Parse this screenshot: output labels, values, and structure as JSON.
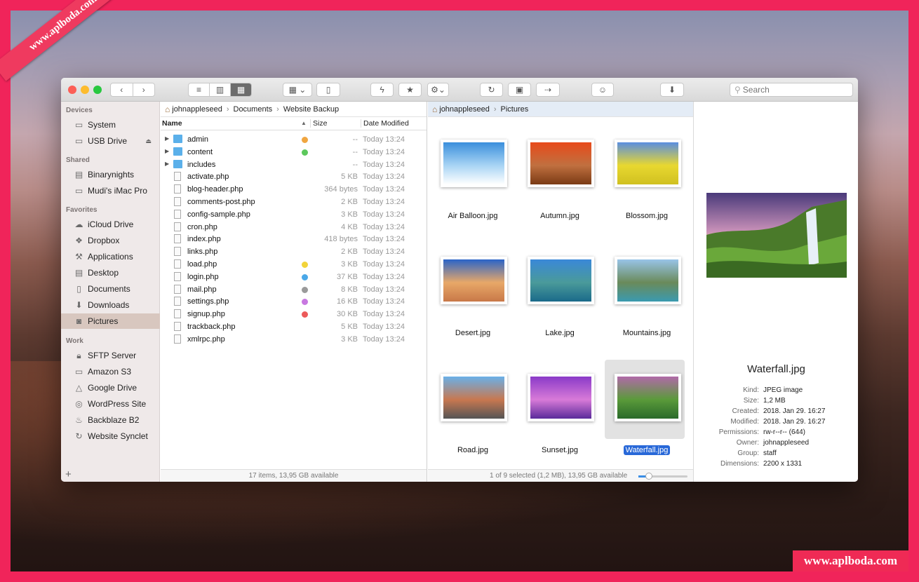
{
  "watermark": {
    "ribbon": "www.aplboda.com",
    "corner": "www.aplboda.com"
  },
  "toolbar": {
    "search_placeholder": "Search"
  },
  "sidebar": {
    "devices": {
      "title": "Devices",
      "items": [
        {
          "label": "System",
          "icon": "hard-drive-icon"
        },
        {
          "label": "USB Drive",
          "icon": "usb-drive-icon"
        }
      ]
    },
    "shared": {
      "title": "Shared",
      "items": [
        {
          "label": "Binarynights",
          "icon": "network-server-icon"
        },
        {
          "label": "Mudi's iMac Pro",
          "icon": "imac-icon"
        }
      ]
    },
    "favorites": {
      "title": "Favorites",
      "items": [
        {
          "label": "iCloud Drive",
          "icon": "cloud-icon"
        },
        {
          "label": "Dropbox",
          "icon": "dropbox-icon"
        },
        {
          "label": "Applications",
          "icon": "applications-icon"
        },
        {
          "label": "Desktop",
          "icon": "desktop-icon"
        },
        {
          "label": "Documents",
          "icon": "documents-icon"
        },
        {
          "label": "Downloads",
          "icon": "downloads-icon"
        },
        {
          "label": "Pictures",
          "icon": "camera-icon"
        }
      ]
    },
    "work": {
      "title": "Work",
      "items": [
        {
          "label": "SFTP Server",
          "icon": "lock-icon"
        },
        {
          "label": "Amazon S3",
          "icon": "bucket-icon"
        },
        {
          "label": "Google Drive",
          "icon": "google-drive-icon"
        },
        {
          "label": "WordPress Site",
          "icon": "wordpress-icon"
        },
        {
          "label": "Backblaze B2",
          "icon": "flame-icon"
        },
        {
          "label": "Website Synclet",
          "icon": "sync-icon"
        }
      ]
    },
    "selected": "Pictures"
  },
  "left_pane": {
    "breadcrumb": [
      "johnappleseed",
      "Documents",
      "Website Backup"
    ],
    "columns": {
      "name": "Name",
      "size": "Size",
      "date": "Date Modified"
    },
    "files": [
      {
        "name": "admin",
        "type": "folder",
        "size": "--",
        "date": "Today 13:24",
        "tag": "#f0a640"
      },
      {
        "name": "content",
        "type": "folder",
        "size": "--",
        "date": "Today 13:24",
        "tag": "#5cc85c"
      },
      {
        "name": "includes",
        "type": "folder",
        "size": "--",
        "date": "Today 13:24",
        "tag": ""
      },
      {
        "name": "activate.php",
        "type": "file",
        "size": "5 KB",
        "date": "Today 13:24",
        "tag": ""
      },
      {
        "name": "blog-header.php",
        "type": "file",
        "size": "364 bytes",
        "date": "Today 13:24",
        "tag": ""
      },
      {
        "name": "comments-post.php",
        "type": "file",
        "size": "2 KB",
        "date": "Today 13:24",
        "tag": ""
      },
      {
        "name": "config-sample.php",
        "type": "file",
        "size": "3 KB",
        "date": "Today 13:24",
        "tag": ""
      },
      {
        "name": "cron.php",
        "type": "file",
        "size": "4 KB",
        "date": "Today 13:24",
        "tag": ""
      },
      {
        "name": "index.php",
        "type": "file",
        "size": "418 bytes",
        "date": "Today 13:24",
        "tag": ""
      },
      {
        "name": "links.php",
        "type": "file",
        "size": "2 KB",
        "date": "Today 13:24",
        "tag": ""
      },
      {
        "name": "load.php",
        "type": "file",
        "size": "3 KB",
        "date": "Today 13:24",
        "tag": "#f2d43a"
      },
      {
        "name": "login.php",
        "type": "file",
        "size": "37 KB",
        "date": "Today 13:24",
        "tag": "#4aa8e8"
      },
      {
        "name": "mail.php",
        "type": "file",
        "size": "8 KB",
        "date": "Today 13:24",
        "tag": "#9a9a9a"
      },
      {
        "name": "settings.php",
        "type": "file",
        "size": "16 KB",
        "date": "Today 13:24",
        "tag": "#c878e0"
      },
      {
        "name": "signup.php",
        "type": "file",
        "size": "30 KB",
        "date": "Today 13:24",
        "tag": "#ec5a5a"
      },
      {
        "name": "trackback.php",
        "type": "file",
        "size": "5 KB",
        "date": "Today 13:24",
        "tag": ""
      },
      {
        "name": "xmlrpc.php",
        "type": "file",
        "size": "3 KB",
        "date": "Today 13:24",
        "tag": ""
      }
    ],
    "status": "17 items, 13,95 GB available"
  },
  "right_pane": {
    "breadcrumb": [
      "johnappleseed",
      "Pictures"
    ],
    "images": [
      {
        "name": "Air Balloon.jpg",
        "colors": [
          "#3a8fdc",
          "#a8d4f4",
          "#ffffff"
        ]
      },
      {
        "name": "Autumn.jpg",
        "colors": [
          "#e84a1a",
          "#c07040",
          "#7a3a14"
        ]
      },
      {
        "name": "Blossom.jpg",
        "colors": [
          "#5a8ee0",
          "#e8d830",
          "#d0c020"
        ]
      },
      {
        "name": "Desert.jpg",
        "colors": [
          "#2a64c8",
          "#e8a868",
          "#c87848"
        ]
      },
      {
        "name": "Lake.jpg",
        "colors": [
          "#3a88d8",
          "#4a9a9a",
          "#1a6a8a"
        ]
      },
      {
        "name": "Mountains.jpg",
        "colors": [
          "#98c4e8",
          "#6a8a5a",
          "#3a9ab0"
        ]
      },
      {
        "name": "Road.jpg",
        "colors": [
          "#6ab0e8",
          "#c87850",
          "#555555"
        ]
      },
      {
        "name": "Sunset.jpg",
        "colors": [
          "#8a3ac8",
          "#d87ad8",
          "#5a2a9a"
        ]
      },
      {
        "name": "Waterfall.jpg",
        "colors": [
          "#b06aa8",
          "#5a9a3a",
          "#2a6a2a"
        ],
        "selected": true
      }
    ],
    "status": "1 of 9 selected (1,2 MB), 13,95 GB available",
    "zoom_level": 0.2
  },
  "preview": {
    "title": "Waterfall.jpg",
    "meta": [
      {
        "k": "Kind:",
        "v": "JPEG image"
      },
      {
        "k": "Size:",
        "v": "1,2 MB"
      },
      {
        "k": "Created:",
        "v": "2018. Jan 29. 16:27"
      },
      {
        "k": "Modified:",
        "v": "2018. Jan 29. 16:27"
      },
      {
        "k": "Permissions:",
        "v": "rw-r--r-- (644)"
      },
      {
        "k": "Owner:",
        "v": "johnappleseed"
      },
      {
        "k": "Group:",
        "v": "staff"
      },
      {
        "k": "Dimensions:",
        "v": "2200 x 1331"
      }
    ]
  }
}
